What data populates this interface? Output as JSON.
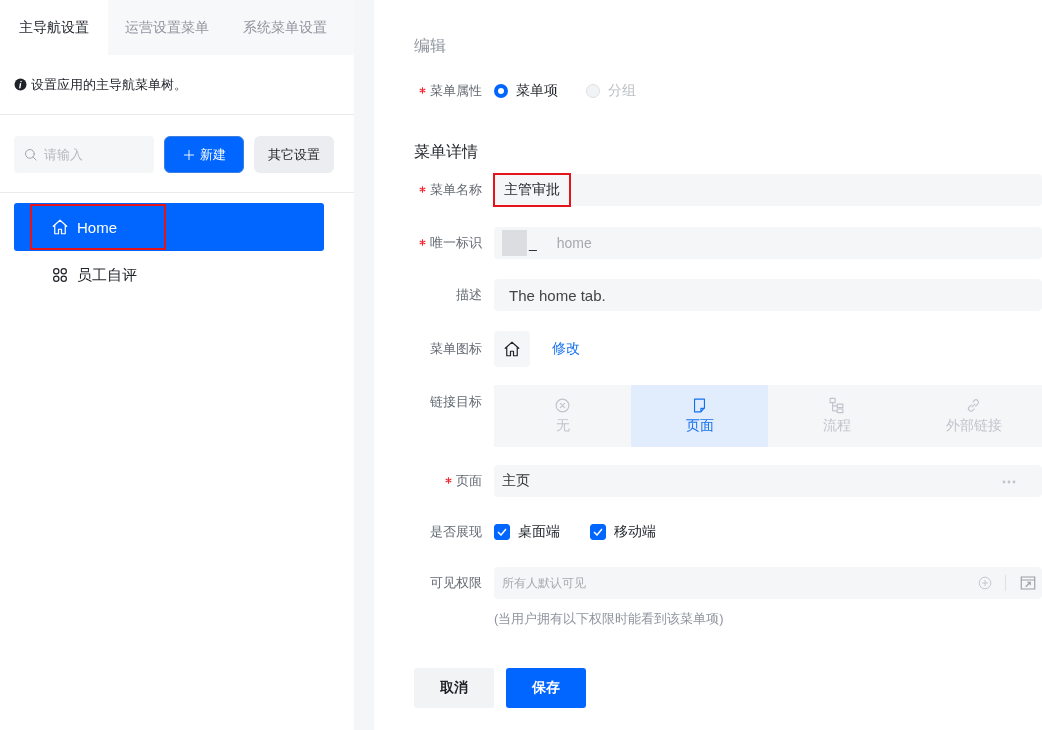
{
  "sidebar": {
    "tabs": [
      {
        "label": "主导航设置",
        "selected": true
      },
      {
        "label": "运营设置菜单",
        "selected": false
      },
      {
        "label": "系统菜单设置",
        "selected": false
      }
    ],
    "info": "设置应用的主导航菜单树。",
    "search": {
      "placeholder": "请输入"
    },
    "new_button": "新建",
    "settings_button": "其它设置",
    "tree": [
      {
        "label": "Home",
        "kind": "home",
        "selected": true,
        "highlighted": true
      },
      {
        "label": "员工自评",
        "kind": "apps",
        "selected": false,
        "highlighted": false
      }
    ]
  },
  "form": {
    "title": "编辑",
    "menu_type": {
      "label": "菜单属性",
      "required": true,
      "options": [
        {
          "label": "菜单项",
          "selected": true,
          "disabled": false
        },
        {
          "label": "分组",
          "selected": false,
          "disabled": true
        }
      ]
    },
    "section_title": "菜单详情",
    "name": {
      "label": "菜单名称",
      "required": true,
      "value": "主管审批",
      "highlighted": true
    },
    "identifier": {
      "label": "唯一标识",
      "required": true,
      "prefix": "_",
      "placeholder": "home"
    },
    "description": {
      "label": "描述",
      "required": false,
      "value": "The home tab."
    },
    "menu_icon": {
      "label": "菜单图标",
      "required": false,
      "kind": "home",
      "action": "修改"
    },
    "link_target": {
      "label": "链接目标",
      "required": false,
      "options": [
        {
          "label": "无",
          "kind": "none",
          "selected": false
        },
        {
          "label": "页面",
          "kind": "page",
          "selected": true
        },
        {
          "label": "流程",
          "kind": "flow",
          "selected": false
        },
        {
          "label": "外部链接",
          "kind": "link",
          "selected": false
        }
      ]
    },
    "page": {
      "label": "页面",
      "required": true,
      "value": "主页"
    },
    "display": {
      "label": "是否展现",
      "required": false,
      "options": [
        {
          "label": "桌面端",
          "checked": true
        },
        {
          "label": "移动端",
          "checked": true
        }
      ]
    },
    "visibility": {
      "label": "可见权限",
      "required": false,
      "placeholder": "所有人默认可见",
      "hint": "(当用户拥有以下权限时能看到该菜单项)"
    },
    "cancel_button": "取消",
    "save_button": "保存"
  }
}
